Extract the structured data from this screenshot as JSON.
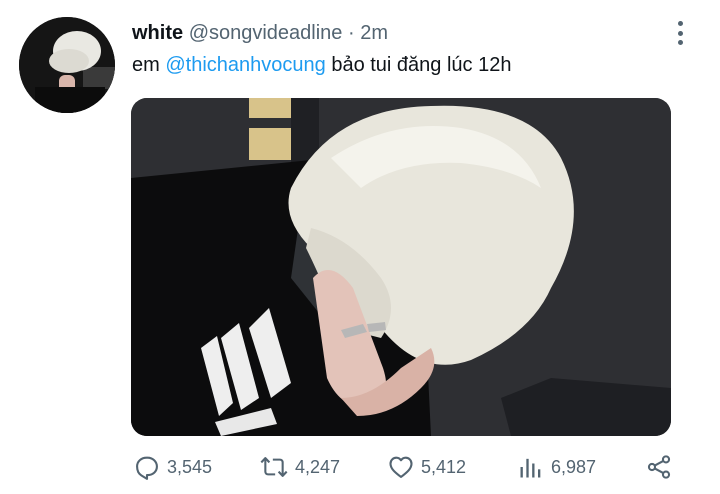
{
  "tweet": {
    "display_name": "white",
    "handle": "@songvideadline",
    "separator": "·",
    "time": "2m",
    "text_before": "em ",
    "mention": "@thichanhvocung",
    "text_after": " bảo tui đăng lúc 12h"
  },
  "actions": {
    "replies": "3,545",
    "retweets": "4,247",
    "likes": "5,412",
    "views": "6,987"
  },
  "icons": {
    "avatar": "avatar",
    "more": "more-vertical-icon",
    "reply": "reply-icon",
    "retweet": "retweet-icon",
    "like": "heart-icon",
    "views": "views-icon",
    "share": "share-icon"
  },
  "colors": {
    "text": "#0f1419",
    "muted": "#536471",
    "link": "#1d9bf0"
  }
}
